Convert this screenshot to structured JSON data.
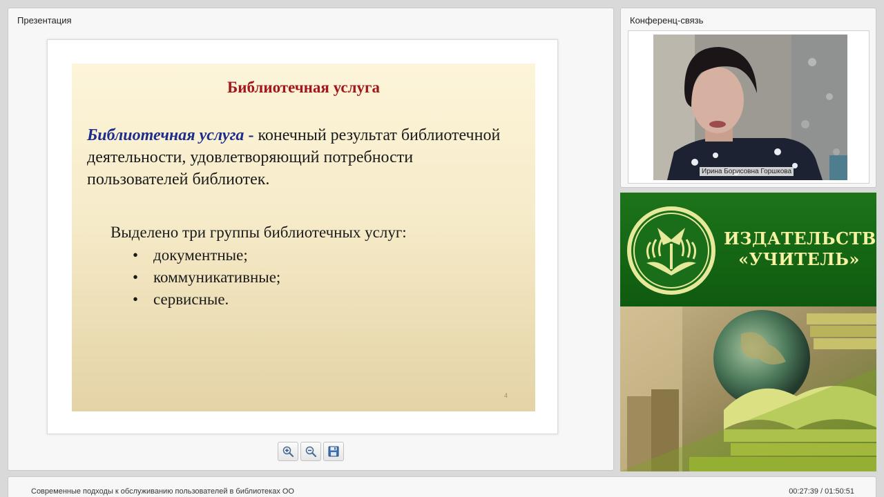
{
  "presentation": {
    "panel_title": "Презентация",
    "slide": {
      "title": "Библиотечная услуга",
      "definition_term": "Библиотечная услуга",
      "definition_dash": "-",
      "definition_text": "конечный результат библиотечной деятельности, удовлетворяющий потребности пользователей библиотек.",
      "groups_intro": "Выделено три группы  библиотечных услуг:",
      "groups": [
        "документные;",
        "коммуникативные;",
        "сервисные."
      ],
      "bullet": "•",
      "slide_number": "4"
    },
    "toolbar": {
      "zoom_in_icon": "zoom-in-icon",
      "zoom_out_icon": "zoom-out-icon",
      "save_icon": "floppy-disk-icon"
    }
  },
  "conference": {
    "panel_title": "Конференц-связь",
    "participant_name": "Ирина Борисовна Горшкова"
  },
  "publisher": {
    "name_line1": "ИЗДАТЕЛЬСТВО",
    "name_line2": "«УЧИТЕЛЬ»"
  },
  "footer": {
    "webinar_title": "Современные подходы к обслуживанию пользователей в библиотеках ОО",
    "time": "00:27:39 / 01:50:51"
  },
  "colors": {
    "slide_title": "#a3161a",
    "term": "#1d2d8c",
    "publisher_green": "#0f5d12",
    "publisher_text": "#f5f2a4"
  }
}
